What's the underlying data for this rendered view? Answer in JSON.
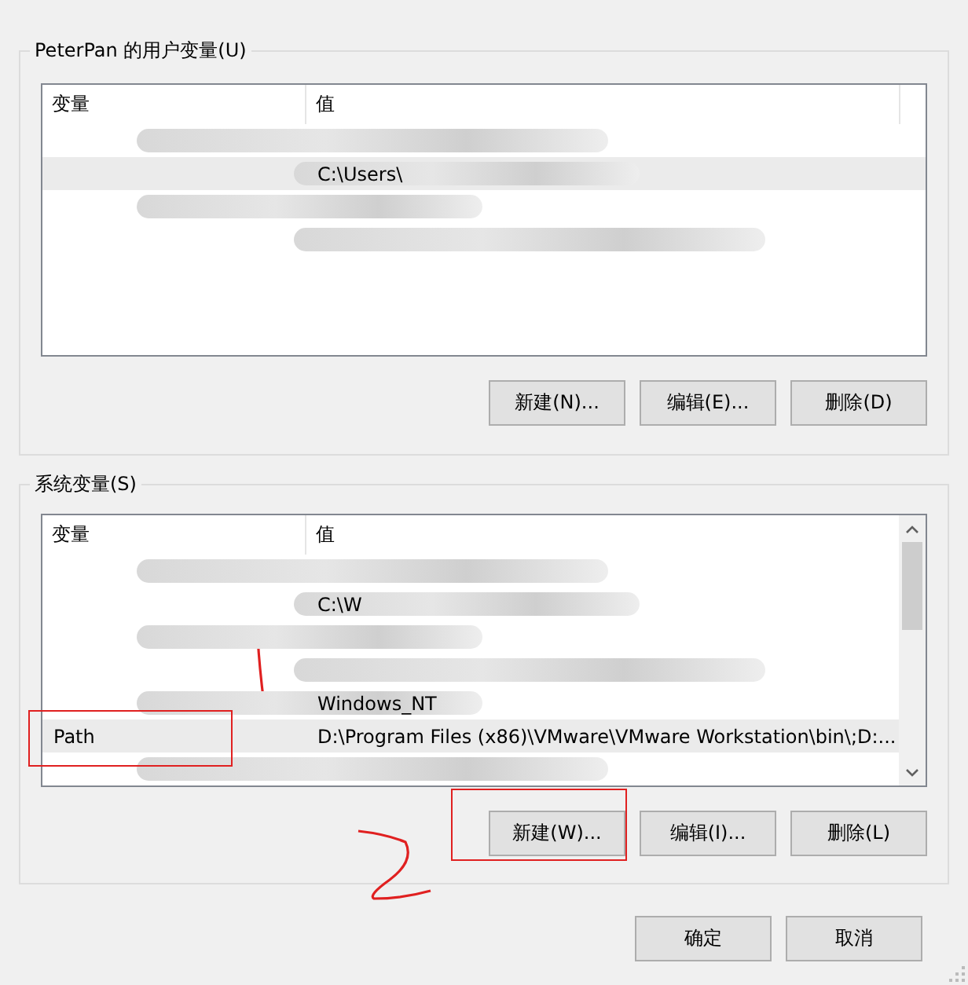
{
  "user_vars": {
    "title": "PeterPan 的用户变量(U)",
    "columns": [
      "变量",
      "值"
    ],
    "rows": [
      {
        "redacted": true,
        "selected": false
      },
      {
        "value": "C:\\Users\\",
        "redacted": true,
        "selected": true
      },
      {
        "redacted": true,
        "selected": false
      },
      {
        "redacted": true,
        "selected": false
      }
    ],
    "buttons": [
      {
        "label": "新建(N)..."
      },
      {
        "label": "编辑(E)..."
      },
      {
        "label": "删除(D)"
      }
    ]
  },
  "system_vars": {
    "title": "系统变量(S)",
    "columns": [
      "变量",
      "值"
    ],
    "rows": [
      {
        "redacted": true,
        "selected": false
      },
      {
        "value": "C:\\W",
        "redacted": true,
        "selected": false
      },
      {
        "redacted": true,
        "selected": false
      },
      {
        "redacted": true,
        "selected": false
      },
      {
        "value": "Windows_NT",
        "redacted": true,
        "selected": false
      },
      {
        "name": "Path",
        "value": "D:\\Program Files (x86)\\VMware\\VMware Workstation\\bin\\;D:...",
        "redacted": false,
        "selected": true,
        "highlighted": true
      },
      {
        "redacted": true,
        "selected": false
      }
    ],
    "buttons": [
      {
        "label": "新建(W)...",
        "highlighted": true
      },
      {
        "label": "编辑(I)..."
      },
      {
        "label": "删除(L)"
      }
    ]
  },
  "dialog_buttons": [
    "确定",
    "取消"
  ],
  "pen_marks": {
    "stroke": true,
    "scribble": true
  }
}
